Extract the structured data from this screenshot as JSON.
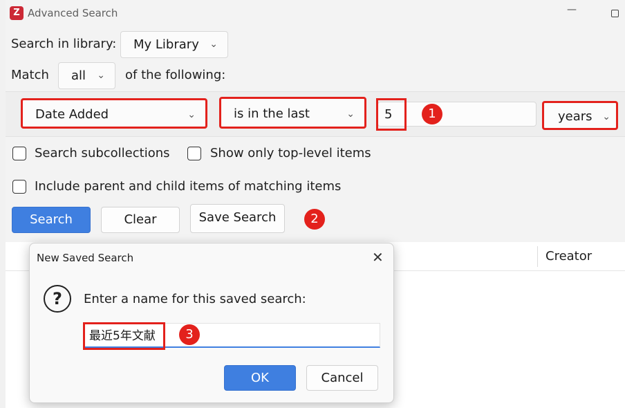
{
  "window": {
    "title": "Advanced Search",
    "app_icon": "Z"
  },
  "search": {
    "library_label": "Search in library:",
    "library_value": "My Library",
    "match_label": "Match",
    "match_value": "all",
    "match_suffix": "of the following:"
  },
  "condition": {
    "field": "Date Added",
    "operator": "is in the last",
    "value": "5",
    "unit": "years"
  },
  "options": {
    "search_subcollections": "Search subcollections",
    "top_level_only": "Show only top-level items",
    "include_parent_child": "Include parent and child items of matching items"
  },
  "buttons": {
    "search": "Search",
    "clear": "Clear",
    "save_search": "Save Search"
  },
  "results": {
    "creator_header": "Creator"
  },
  "dialog": {
    "title": "New Saved Search",
    "prompt": "Enter a name for this saved search:",
    "name_value": "最近5年文献",
    "ok": "OK",
    "cancel": "Cancel"
  },
  "annotations": {
    "badge1": "1",
    "badge2": "2",
    "badge3": "3"
  },
  "colors": {
    "highlight": "#e3211c",
    "primary": "#3f7fe0",
    "brand": "#cc2936"
  }
}
